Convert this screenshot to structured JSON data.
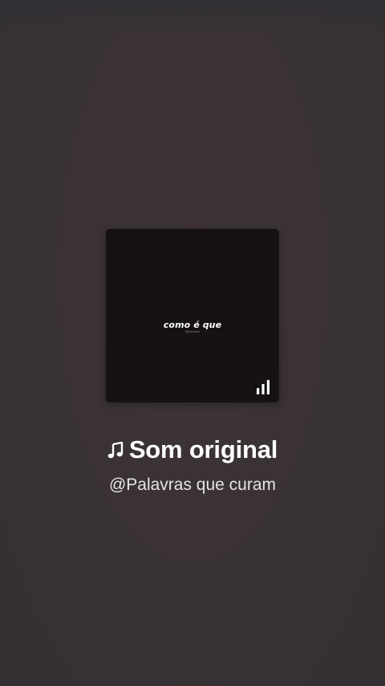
{
  "cover": {
    "text": "como é que",
    "handle": "@rredlvan",
    "icon": "audio-bars-icon"
  },
  "sound": {
    "icon": "music-note-icon",
    "title": "Som original",
    "author": "@Palavras que curam"
  }
}
